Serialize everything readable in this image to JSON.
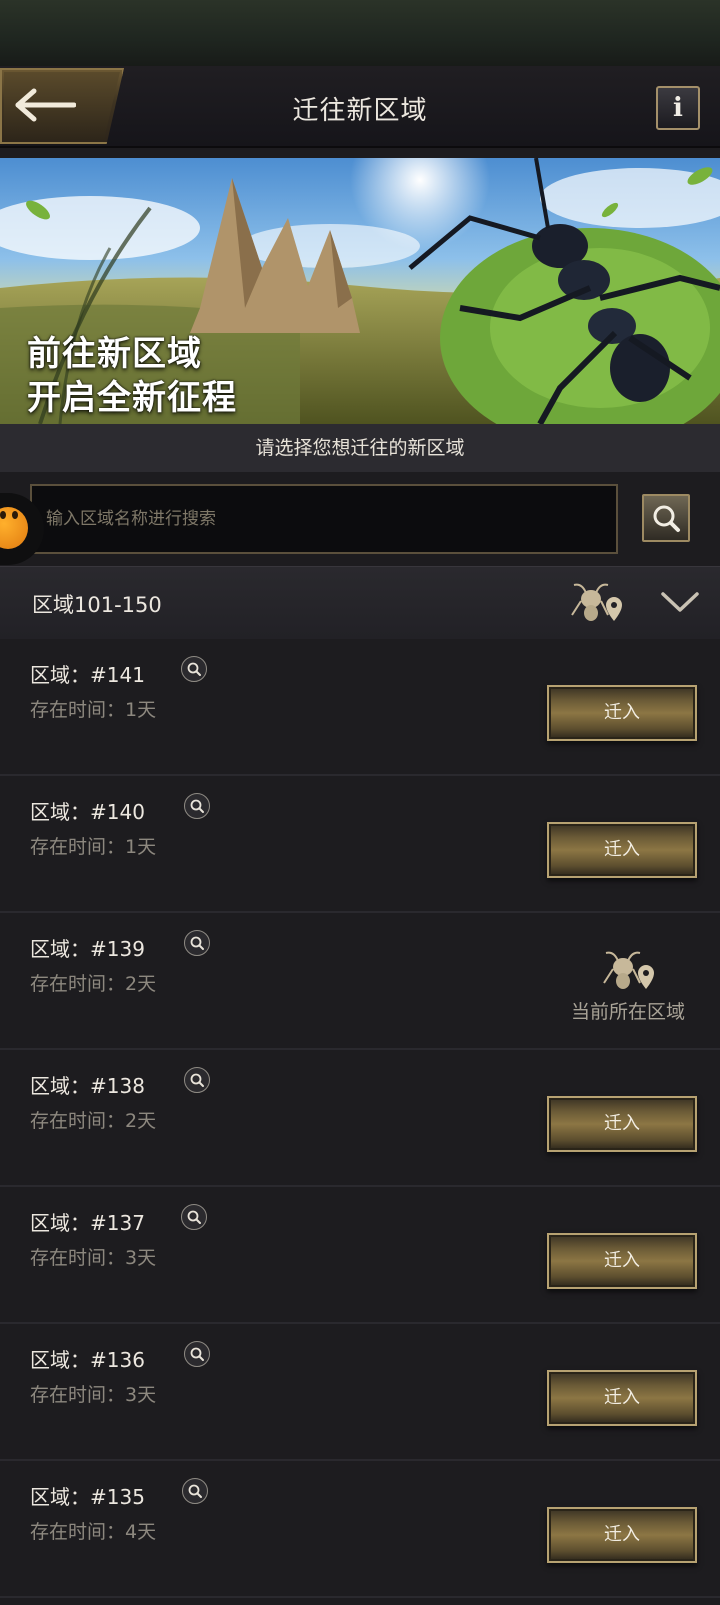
{
  "header": {
    "title": "迁往新区域",
    "back_icon": "back-arrow-icon",
    "info_label": "i"
  },
  "banner": {
    "line1": "前往新区域",
    "line2": "开启全新征程"
  },
  "subtitle": "请选择您想迁往的新区域",
  "search": {
    "placeholder": "输入区域名称进行搜索",
    "button_icon": "search-icon"
  },
  "group": {
    "label": "区域101-150",
    "expanded": true
  },
  "regions": [
    {
      "name": "区域：#141",
      "time": "存在时间：1天",
      "action": "迁入"
    },
    {
      "name": "区域：#140",
      "time": "存在时间：1天",
      "action": "迁入"
    },
    {
      "name": "区域：#139",
      "time": "存在时间：2天",
      "current_label": "当前所在区域"
    },
    {
      "name": "区域：#138",
      "time": "存在时间：2天",
      "action": "迁入"
    },
    {
      "name": "区域：#137",
      "time": "存在时间：3天",
      "action": "迁入"
    },
    {
      "name": "区域：#136",
      "time": "存在时间：3天",
      "action": "迁入"
    },
    {
      "name": "区域：#135",
      "time": "存在时间：4天",
      "action": "迁入"
    }
  ],
  "colors": {
    "background": "#1d1c1f",
    "gold_border": "#b7a272",
    "text": "#ece7df",
    "muted_text": "#8d887f"
  }
}
